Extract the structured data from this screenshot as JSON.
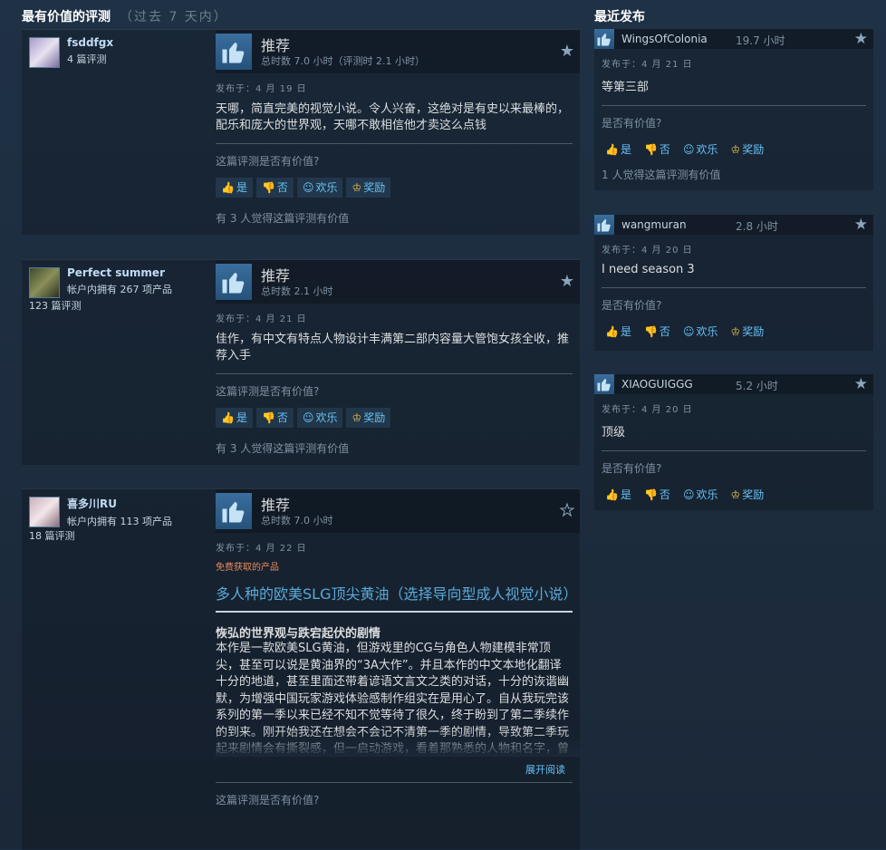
{
  "header": {
    "top_title": "最有价值的评测",
    "top_subtitle": "（过去 7 天内）",
    "recent_title": "最近发布"
  },
  "reviews": [
    {
      "author": "fsddfgx",
      "products": "",
      "review_count": "4 篇评测",
      "verdict": "推荐",
      "hours": "总时数 7.0 小时（评测时 2.1 小时）",
      "date": "发布于：4 月 19 日",
      "text": "天哪，简直完美的视觉小说。令人兴奋，这绝对是有史以来最棒的，配乐和庞大的世界观，天哪不敢相信他才卖这么点钱",
      "helpful_q": "这篇评测是否有价值?",
      "found": "有 3 人觉得这篇评测有价值"
    },
    {
      "author": "Perfect summer",
      "products": "帐户内拥有 267 项产品",
      "review_count": "123 篇评测",
      "verdict": "推荐",
      "hours": "总时数 2.1 小时",
      "date": "发布于：4 月 21 日",
      "text": "佳作，有中文有特点人物设计丰满第二部内容量大管饱女孩全收，推荐入手",
      "helpful_q": "这篇评测是否有价值?",
      "found": "有 3 人觉得这篇评测有价值"
    },
    {
      "author": "喜多川RU",
      "products": "帐户内拥有 113 项产品",
      "review_count": "18 篇评测",
      "verdict": "推荐",
      "hours": "总时数 7.0 小时",
      "date": "发布于：4 月 22 日",
      "free": "免费获取的产品",
      "big_title": "多人种的欧美SLG顶尖黄油（选择导向型成人视觉小说）",
      "subhead": "恢弘的世界观与跌宕起伏的剧情",
      "text": "本作是一款欧美SLG黄油，但游戏里的CG与角色人物建模非常顶尖，甚至可以说是黄油界的“3A大作”。并且本作的中文本地化翻译十分的地道，甚至里面还带着谚语文言文之类的对话，十分的诙谐幽默，为增强中国玩家游戏体验感制作组实在是用心了。自从我玩完该系列的第一季以来已经不知不觉等待了很久，终于盼到了第二季续作的到来。刚开始我还在想会不会记不清第一季的剧情，导致第二季玩起来剧情会有撕裂感，但一启动游戏，看着那熟悉的人物和名字，曾经发生的的故事就一下子都想起来了。这也侧面证明了这部作品故事",
      "read_more": "展开阅读",
      "helpful_q": "这篇评测是否有价值?"
    }
  ],
  "votes": {
    "yes": "是",
    "no": "否",
    "funny": "欢乐",
    "award": "奖励"
  },
  "recent": [
    {
      "author": "WingsOfColonia",
      "hours": "19.7 小时",
      "date": "发布于：4 月 21 日",
      "text": "等第三部",
      "helpful_q": "是否有价值?",
      "found": "1 人觉得这篇评测有价值"
    },
    {
      "author": "wangmuran",
      "hours": "2.8 小时",
      "date": "发布于：4 月 20 日",
      "text": "I need season 3",
      "helpful_q": "是否有价值?"
    },
    {
      "author": "XIAOGUIGGG",
      "hours": "5.2 小时",
      "date": "发布于：4 月 20 日",
      "text": "顶级",
      "helpful_q": "是否有价值?"
    }
  ],
  "icons": {
    "thumb": "thumbs-up-icon",
    "star": "star-icon",
    "award": "award-icon"
  },
  "colors": {
    "accent": "#67c1f5",
    "background": "#1b2838",
    "free_label": "#e88a5a"
  }
}
